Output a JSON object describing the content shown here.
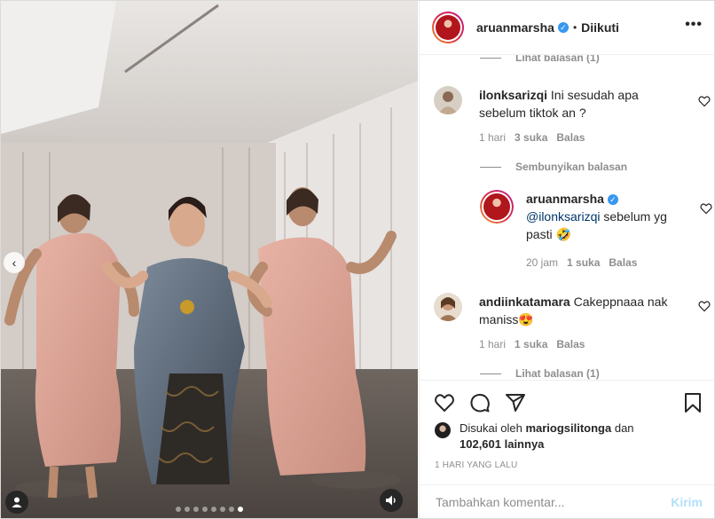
{
  "colors": {
    "accent": "#0095f6",
    "verified": "#3897f0",
    "muted": "#8e8e8e",
    "post_disabled": "#b2dffc",
    "mention": "#00376b"
  },
  "media": {
    "prev_icon": "chevron-left-icon",
    "dots_count": 8,
    "active_dot": 7,
    "user_tag_icon": "user-icon",
    "sound_icon": "speaker-icon"
  },
  "header": {
    "username": "aruanmarsha",
    "bullet": "•",
    "follow_status": "Diikuti",
    "more_icon": "more-horizontal-icon",
    "more_label": "•••"
  },
  "comments": {
    "top_thread": "Lihat balasan (1)",
    "items": [
      {
        "username": "ilonksarizqi",
        "text": "Ini sesudah apa sebelum tiktok an ?",
        "time": "1 hari",
        "likes": "3 suka",
        "reply": "Balas"
      }
    ],
    "hide_replies": "Sembunyikan balasan",
    "reply": {
      "username": "aruanmarsha",
      "mention": "@ilonksarizqi",
      "text": " sebelum yg pasti 🤣",
      "time": "20 jam",
      "likes": "1 suka",
      "reply": "Balas"
    },
    "second": {
      "username": "andiinkatamara",
      "text": "Cakeppnaaa nak maniss😍",
      "time": "1 hari",
      "likes": "1 suka",
      "reply": "Balas"
    },
    "bottom_thread": "Lihat balasan (1)"
  },
  "actions": {
    "liked_by_prefix": "Disukai oleh ",
    "liked_by_user": "mariogsilitonga",
    "liked_by_and": " dan",
    "liked_by_count": "102,601 lainnya",
    "posted_time": "1 HARI YANG LALU",
    "comment_placeholder": "Tambahkan komentar...",
    "post_label": "Kirim"
  }
}
